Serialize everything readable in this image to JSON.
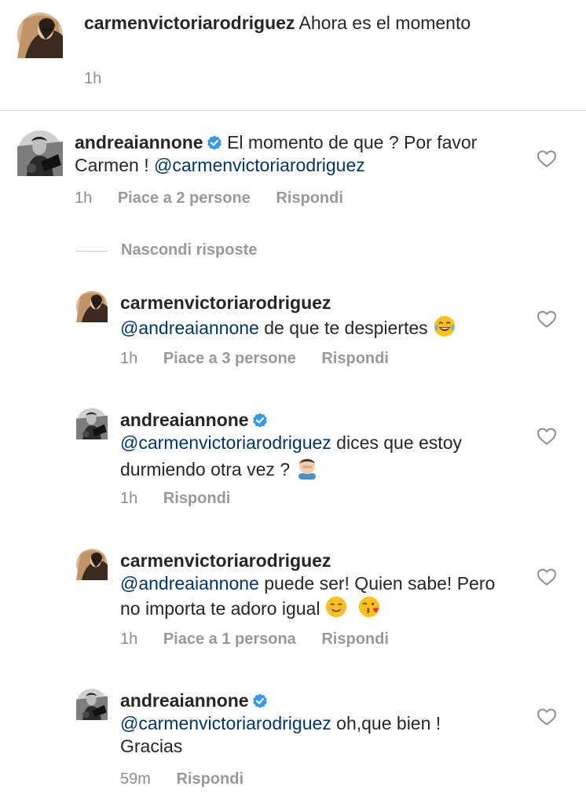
{
  "caption": {
    "username": "carmenvictoriarodriguez",
    "text": "Ahora es el momento",
    "time": "1h"
  },
  "comments": [
    {
      "username": "andreaiannone",
      "verified": true,
      "text": "El momento de que ? Por favor Carmen !",
      "mention": "@carmenvictoriarodriguez",
      "time": "1h",
      "likes": "Piace a 2 persone",
      "reply_label": "Rispondi"
    }
  ],
  "hide_replies_label": "Nascondi risposte",
  "replies": [
    {
      "username": "carmenvictoriarodriguez",
      "mention": "@andreaiannone",
      "text": "de que te despiertes",
      "emoji": [
        "face-with-tears-of-joy"
      ],
      "time": "1h",
      "likes": "Piace a 3 persone",
      "reply_label": "Rispondi"
    },
    {
      "username": "andreaiannone",
      "verified": true,
      "mention": "@carmenvictoriarodriguez",
      "text": "dices que estoy durmiendo otra vez ?",
      "emoji": [
        "man-facepalming"
      ],
      "time": "1h",
      "reply_label": "Rispondi"
    },
    {
      "username": "carmenvictoriarodriguez",
      "mention": "@andreaiannone",
      "text": "puede ser! Quien sabe! Pero no importa te adoro igual",
      "emoji": [
        "smiling-face",
        "face-blowing-a-kiss"
      ],
      "time": "1h",
      "likes": "Piace a 1 persona",
      "reply_label": "Rispondi"
    },
    {
      "username": "andreaiannone",
      "verified": true,
      "mention": "@carmenvictoriarodriguez",
      "text": "oh,que bien ! Gracias",
      "time": "59m",
      "reply_label": "Rispondi"
    }
  ],
  "icons": {
    "verified": "verified-badge-icon",
    "like": "heart-icon"
  },
  "colors": {
    "text": "#262626",
    "mention": "#003569",
    "meta": "#8e8e8e",
    "verified": "#3897f0",
    "divider": "#dbdbdb"
  }
}
